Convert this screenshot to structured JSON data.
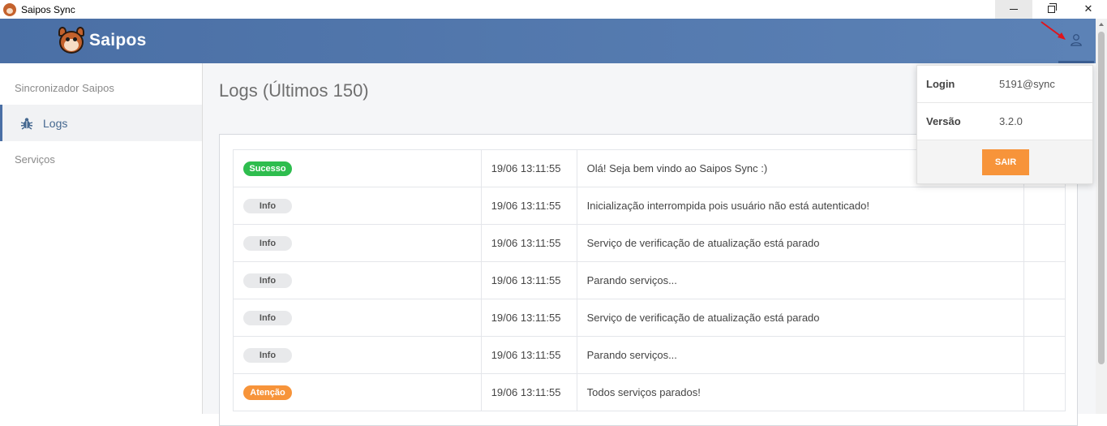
{
  "window": {
    "title": "Saipos Sync",
    "minimize_glyph": "—",
    "close_glyph": "✕"
  },
  "header": {
    "brand": "Saipos",
    "icon": "user-icon"
  },
  "sidebar": {
    "section_title": "Sincronizador Saipos",
    "items": [
      {
        "label": "Logs",
        "icon": "bug-icon",
        "active": true
      }
    ],
    "section_services": "Serviços"
  },
  "main": {
    "title": "Logs (Últimos 150)"
  },
  "logs": [
    {
      "level": "Sucesso",
      "time": "19/06 13:11:55",
      "message": "Olá! Seja bem vindo ao Saipos Sync :)"
    },
    {
      "level": "Info",
      "time": "19/06 13:11:55",
      "message": "Inicialização interrompida pois usuário não está autenticado!"
    },
    {
      "level": "Info",
      "time": "19/06 13:11:55",
      "message": "Serviço de verificação de atualização está parado"
    },
    {
      "level": "Info",
      "time": "19/06 13:11:55",
      "message": "Parando serviços..."
    },
    {
      "level": "Info",
      "time": "19/06 13:11:55",
      "message": "Serviço de verificação de atualização está parado"
    },
    {
      "level": "Info",
      "time": "19/06 13:11:55",
      "message": "Parando serviços..."
    },
    {
      "level": "Atenção",
      "time": "19/06 13:11:55",
      "message": "Todos serviços parados!"
    }
  ],
  "badge_colors": {
    "Sucesso": {
      "bg": "#2ebd4e",
      "fg": "#ffffff"
    },
    "Info": {
      "bg": "#e8e9eb",
      "fg": "#555555"
    },
    "Atenção": {
      "bg": "#f7943a",
      "fg": "#ffffff"
    }
  },
  "user_menu": {
    "login_label": "Login",
    "login_value": "5191@sync",
    "version_label": "Versão",
    "version_value": "3.2.0",
    "logout_label": "SAIR"
  },
  "colors": {
    "header_start": "#4a6fa5",
    "header_end": "#5c82b6",
    "accent_orange": "#f7943a",
    "annotation_red": "#e0141b"
  }
}
